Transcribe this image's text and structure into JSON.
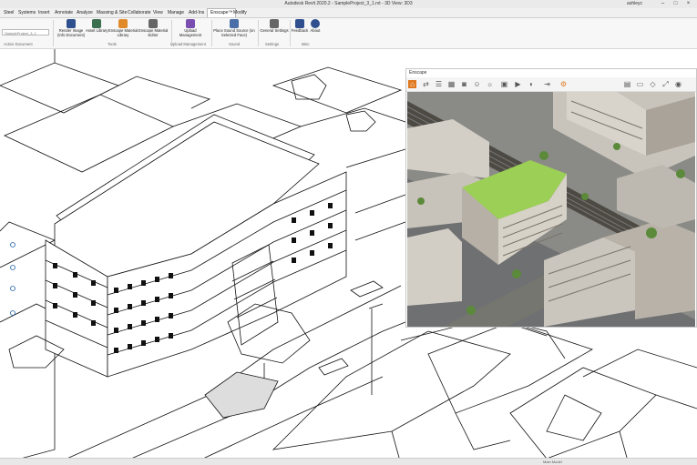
{
  "app": {
    "title": "Autodesk Revit 2020.2 - SampleProject_3_1.rvt - 3D View: 3D3",
    "user": "ashleyc"
  },
  "tabs": [
    "Steel",
    "Systems",
    "Insert",
    "Annotate",
    "Analyze",
    "Massing & Site",
    "Collaborate",
    "View",
    "Manage",
    "Add-Ins",
    "Enscape™",
    "Modify"
  ],
  "active_tab": "Enscape™",
  "doc_selector": "SampleProject_3_1",
  "ribbon": {
    "buttons": [
      {
        "label1": "Render Image",
        "label2": "(Info Document)"
      },
      {
        "label1": "Asset Library",
        "label2": ""
      },
      {
        "label1": "Enscape Material",
        "label2": "Library"
      },
      {
        "label1": "Enscape Material",
        "label2": "Editor"
      },
      {
        "label1": "Upload",
        "label2": "Management"
      },
      {
        "label1": "Place Sound Source (on",
        "label2": "Selected Face)"
      },
      {
        "label1": "General Settings",
        "label2": ""
      },
      {
        "label1": "Feedback",
        "label2": ""
      },
      {
        "label1": "About",
        "label2": ""
      }
    ],
    "panels": [
      "Active Document",
      "Tools",
      "Upload Management",
      "Sound",
      "Settings",
      "Misc"
    ],
    "icon_colors": [
      "#2f4f8f",
      "#3b6f4e",
      "#e08a2a",
      "#666666",
      "#7a4fb0",
      "#4a6fa8",
      "#666666",
      "#2f4f8f",
      "#2f4f8f"
    ]
  },
  "viewer": {
    "title": "Enscape",
    "toolbar_icons": [
      "home-icon",
      "walk-icon",
      "menu-icon",
      "grid-icon",
      "car-icon",
      "people-icon",
      "sun-icon",
      "screenshot-icon",
      "video-icon",
      "panorama-icon",
      "export-icon",
      "settings-icon"
    ]
  },
  "status": {
    "model": "Main Model"
  }
}
